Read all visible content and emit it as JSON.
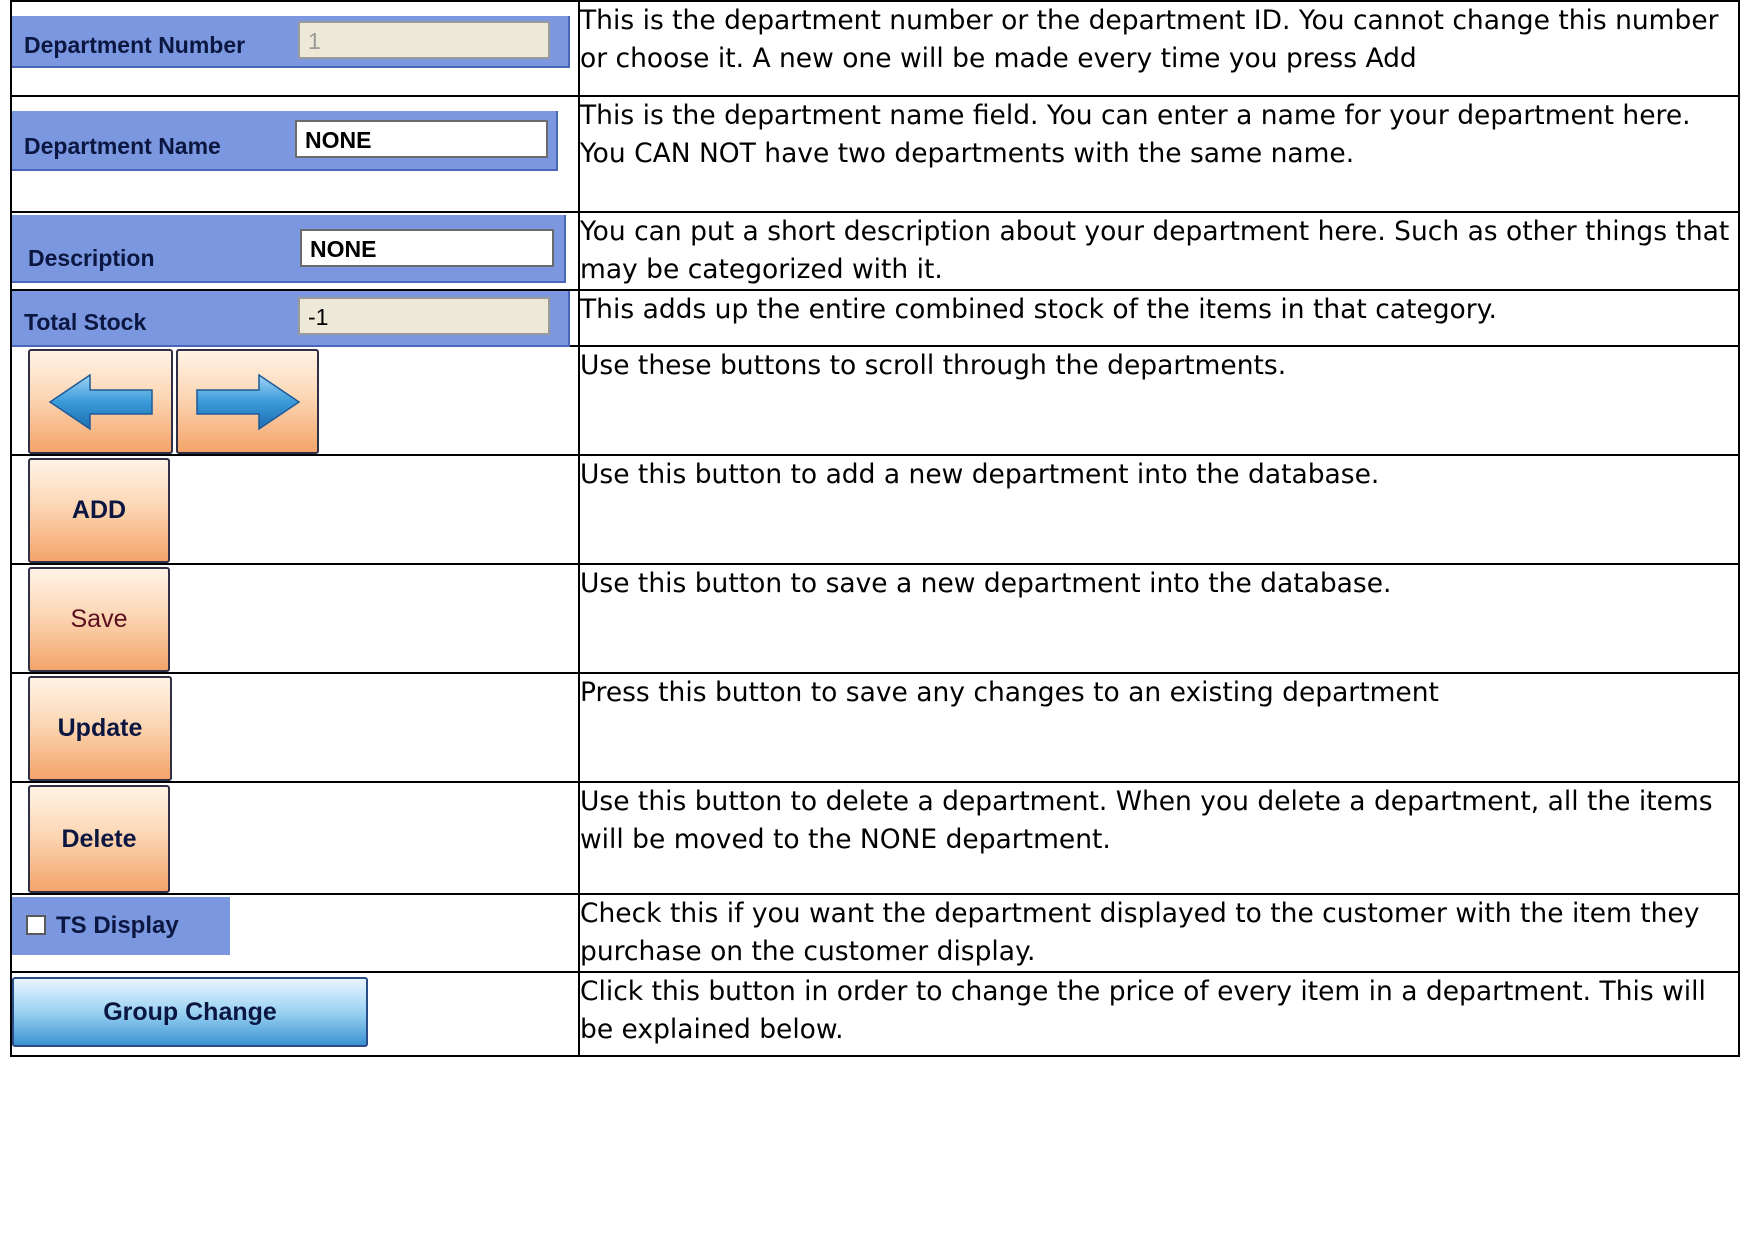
{
  "rows": [
    {
      "label": "Department Number",
      "value": "1",
      "description": "This is the department number or the department ID.  You cannot change this number or choose it.  A new one will be made every time you press Add"
    },
    {
      "label": "Department Name",
      "value": "NONE",
      "description": "This is the department name field.  You can enter a name for your department here.  You CAN NOT have two departments with the same name."
    },
    {
      "label": "Description",
      "value": "NONE",
      "description": "You can put a short description about your department here. Such as other things that may be categorized with it."
    },
    {
      "label": "Total Stock",
      "value": "-1",
      "description": "This adds up the entire combined stock of the items in that category."
    },
    {
      "description": "Use these buttons to scroll through the departments."
    },
    {
      "button": "ADD",
      "description": "Use this button to add a new department into the database."
    },
    {
      "button": "Save",
      "description": "Use this button to save a new department into the database."
    },
    {
      "button": "Update",
      "description": "Press this button to save any changes to an existing department"
    },
    {
      "button": "Delete",
      "description": "Use this button to delete a department.  When you delete a department, all the items will be moved to the NONE department."
    },
    {
      "checkbox": "TS Display",
      "checked": false,
      "description": "Check this if you want the department displayed to the customer with the item they purchase on the customer display."
    },
    {
      "button": "Group Change",
      "description": "Click this button in order to change the price of every item in a department. This will be explained below."
    }
  ],
  "colors": {
    "panel": "#7b97e0",
    "field_readonly": "#ece9d8",
    "arrow": "#3a9ad9",
    "orange_button": "#f4a46a",
    "blue_button": "#3b93d3"
  },
  "icons": [
    "left-arrow-icon",
    "right-arrow-icon"
  ]
}
